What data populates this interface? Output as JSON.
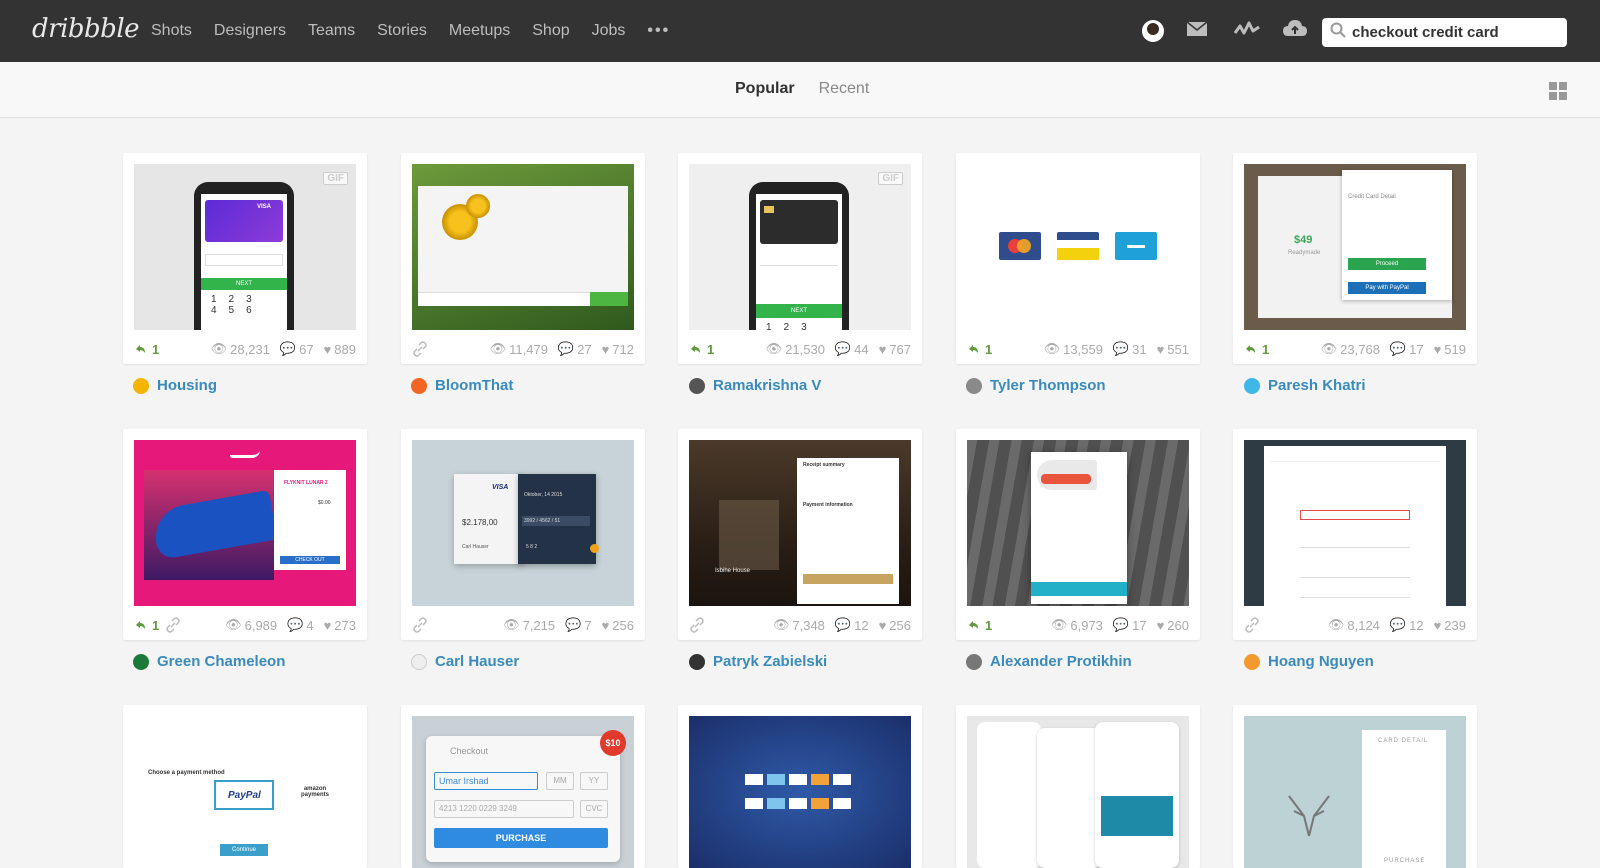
{
  "brand": "dribbble",
  "nav": {
    "links": [
      "Shots",
      "Designers",
      "Teams",
      "Stories",
      "Meetups",
      "Shop",
      "Jobs"
    ],
    "more": "•••",
    "search_value": "checkout credit card"
  },
  "tabs": {
    "popular": "Popular",
    "recent": "Recent"
  },
  "shots": [
    {
      "rebounds": "1",
      "views": "28,231",
      "comments": "67",
      "likes": "889",
      "author": "Housing",
      "gif": "GIF"
    },
    {
      "rebounds": "",
      "views": "11,479",
      "comments": "27",
      "likes": "712",
      "author": "BloomThat",
      "gif": ""
    },
    {
      "rebounds": "1",
      "views": "21,530",
      "comments": "44",
      "likes": "767",
      "author": "Ramakrishna V",
      "gif": "GIF"
    },
    {
      "rebounds": "1",
      "views": "13,559",
      "comments": "31",
      "likes": "551",
      "author": "Tyler Thompson",
      "gif": ""
    },
    {
      "rebounds": "1",
      "views": "23,768",
      "comments": "17",
      "likes": "519",
      "author": "Paresh Khatri",
      "gif": ""
    },
    {
      "rebounds": "1",
      "views": "6,989",
      "comments": "4",
      "likes": "273",
      "author": "Green Chameleon",
      "gif": ""
    },
    {
      "rebounds": "",
      "views": "7,215",
      "comments": "7",
      "likes": "256",
      "author": "Carl Hauser",
      "gif": ""
    },
    {
      "rebounds": "",
      "views": "7,348",
      "comments": "12",
      "likes": "256",
      "author": "Patryk Zabielski",
      "gif": ""
    },
    {
      "rebounds": "1",
      "views": "6,973",
      "comments": "17",
      "likes": "260",
      "author": "Alexander Protikhin",
      "gif": ""
    },
    {
      "rebounds": "",
      "views": "8,124",
      "comments": "12",
      "likes": "239",
      "author": "Hoang Nguyen",
      "gif": ""
    }
  ],
  "thumb_text": {
    "paresh_price": "$49",
    "paresh_sub": "Readymade",
    "paresh_title": "Credit Card Detail",
    "paresh_proceed": "Proceed",
    "paresh_paypal": "Pay with PayPal",
    "carl_total": "$2.178,00",
    "carl_brand": "VISA",
    "carl_name": "Carl Hauser",
    "carl_exp": "Oktober, 14   2015",
    "carl_num": "3992 / 4562 / 51",
    "carl_cvc": "5   8   2",
    "nike_title": "FLYKNIT LUNAR 2",
    "nike_price": "$0.00",
    "nike_checkout": "CHECK OUT",
    "patryk_title": "Receipt summary",
    "patryk_pay": "Payment information",
    "patryk_house": "Isbihe House",
    "checkout_title": "Checkout",
    "checkout_name": "Umar Irshad",
    "checkout_mm": "MM",
    "checkout_yy": "YY",
    "checkout_card": "4213  1220  0229  3249",
    "checkout_cvc": "CVC",
    "checkout_badge": "$10",
    "checkout_btn": "PURCHASE",
    "pm_title": "Choose a payment method",
    "pm_paypal": "PayPal",
    "pm_amazon": "amazon payments",
    "pm_continue": "Continue",
    "card_detail": "CARD DETAIL",
    "card_purchase": "PURCHASE",
    "next": "NEXT",
    "visa": "VISA"
  },
  "colors": {
    "nav_bg": "#333333",
    "link_blue": "#3a8bbb",
    "rebound_green": "#5f9a3c",
    "accent_pink": "#ea4c89"
  }
}
